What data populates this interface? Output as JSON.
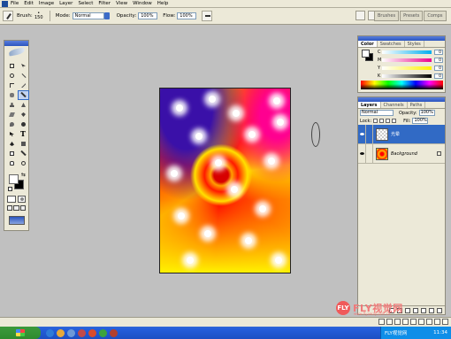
{
  "menu": [
    "File",
    "Edit",
    "Image",
    "Layer",
    "Select",
    "Filter",
    "View",
    "Window",
    "Help"
  ],
  "options": {
    "brush_label": "Brush:",
    "brush_size": "150",
    "mode_label": "Mode:",
    "mode_value": "Normal",
    "opacity_label": "Opacity:",
    "opacity_value": "100%",
    "flow_label": "Flow:",
    "flow_value": "100%"
  },
  "palette_well": [
    "Brushes",
    "Presets",
    "Comps"
  ],
  "color_panel": {
    "tabs": [
      "Color",
      "Swatches",
      "Styles"
    ],
    "channels": [
      {
        "name": "C",
        "value": "0",
        "gradient": "linear-gradient(90deg,#ffffff,#00aeef)"
      },
      {
        "name": "M",
        "value": "0",
        "gradient": "linear-gradient(90deg,#ffffff,#ec008c)"
      },
      {
        "name": "Y",
        "value": "0",
        "gradient": "linear-gradient(90deg,#ffffff,#fff200)"
      },
      {
        "name": "K",
        "value": "0",
        "gradient": "linear-gradient(90deg,#ffffff,#000000)"
      }
    ]
  },
  "layers_panel": {
    "tabs": [
      "Layers",
      "Channels",
      "Paths"
    ],
    "blend_mode": "Normal",
    "opacity_label": "Opacity:",
    "opacity_value": "100%",
    "lock_label": "Lock:",
    "fill_label": "Fill:",
    "fill_value": "100%",
    "layers": [
      {
        "name": "光晕",
        "selected": true
      },
      {
        "name": "Background",
        "selected": false
      }
    ]
  },
  "watermark": {
    "logo": "FLY",
    "text": "FLY视觉网",
    "sub": "www.flyaway.com.cn"
  },
  "taskbar": {
    "app": "FLY视觉网",
    "clock": "11:34"
  },
  "colors": {
    "accent": "#316ac5",
    "chrome": "#ece9d8",
    "workspace": "#c0c0c0"
  }
}
